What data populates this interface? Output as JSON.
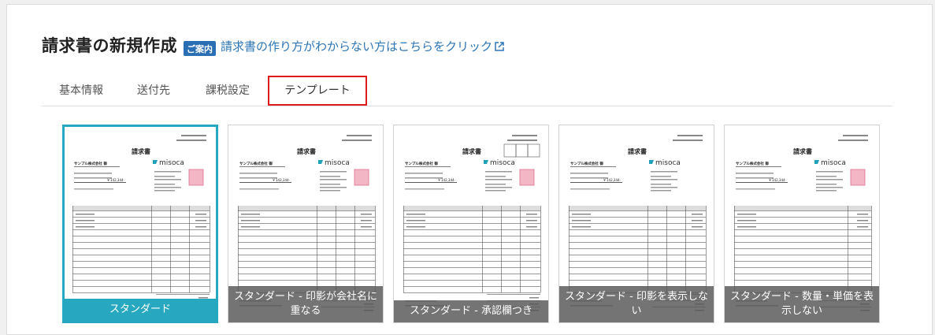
{
  "header": {
    "title": "請求書の新規作成",
    "badge": "ご案内",
    "help_link": "請求書の作り方がわからない方はこちらをクリック"
  },
  "tabs": [
    {
      "label": "基本情報",
      "active": false
    },
    {
      "label": "送付先",
      "active": false
    },
    {
      "label": "課税設定",
      "active": false
    },
    {
      "label": "テンプレート",
      "active": true
    }
  ],
  "templates": [
    {
      "label": "スタンダード",
      "selected": true
    },
    {
      "label": "スタンダード - 印影が会社名に重なる",
      "selected": false
    },
    {
      "label": "スタンダード - 承認欄つき",
      "selected": false
    },
    {
      "label": "スタンダード - 印影を表示しない",
      "selected": false
    },
    {
      "label": "スタンダード - 数量・単価を表示しない",
      "selected": false
    }
  ],
  "invoice_preview": {
    "heading": "請求書",
    "recipient": "サンプル株式会社 御",
    "brand": "misoca",
    "amount": "¥ 142,344-"
  },
  "colors": {
    "accent": "#28a8c0",
    "link": "#2e75b5",
    "highlight_border": "#e01b1b",
    "badge": "#2a6fb3"
  }
}
